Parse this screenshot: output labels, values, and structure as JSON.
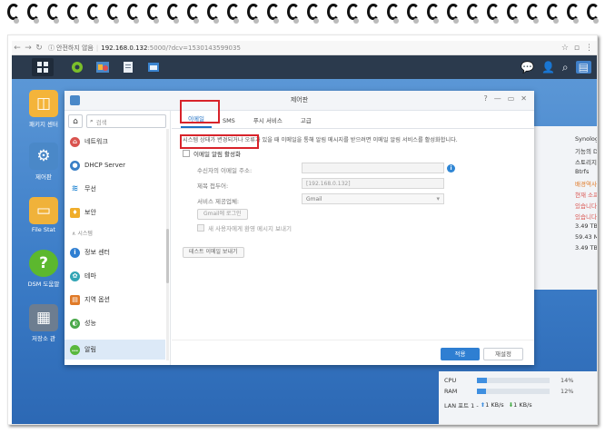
{
  "browser": {
    "security_label": "안전하지 않음",
    "host": "192.168.0.132",
    "path": ":5000/?dcv=1530143599035"
  },
  "desktop_icons": [
    {
      "label": "패키지 센터",
      "icon": "package-icon"
    },
    {
      "label": "제어판",
      "icon": "control-panel-icon"
    },
    {
      "label": "File Stat",
      "icon": "folder-icon"
    },
    {
      "label": "DSM 도움말",
      "icon": "help-icon"
    },
    {
      "label": "저장소 관",
      "icon": "storage-icon"
    }
  ],
  "widget_lines": [
    "Synolog",
    "기능의 D",
    "스토리지",
    "Btrfs",
    "배경역사",
    "현재 소프",
    "있습니다",
    "있습니다",
    "3.49 TB",
    "59.43 M",
    "3.49 TB"
  ],
  "window": {
    "title": "제어판",
    "search_placeholder": "검색",
    "sidebar_items": [
      {
        "label": "네트워크",
        "icon": "network-icon",
        "color": "#d9534f"
      },
      {
        "label": "DHCP Server",
        "icon": "dhcp-icon",
        "color": "#3a7fc6"
      },
      {
        "label": "무선",
        "icon": "wifi-icon",
        "color": "#2a8ad4"
      },
      {
        "label": "보안",
        "icon": "shield-icon",
        "color": "#f0ad2a"
      }
    ],
    "sidebar_group": "시스템",
    "sidebar_items2": [
      {
        "label": "정보 센터",
        "icon": "info-icon",
        "color": "#2f7fd2"
      },
      {
        "label": "테마",
        "icon": "theme-icon",
        "color": "#33a5b5"
      },
      {
        "label": "지역 옵션",
        "icon": "region-icon",
        "color": "#e07a28"
      },
      {
        "label": "성능",
        "icon": "performance-icon",
        "color": "#4aa84a"
      },
      {
        "label": "알림",
        "icon": "notification-icon",
        "color": "#59b83d"
      }
    ],
    "tabs": [
      "이메일",
      "SMS",
      "푸시 서비스",
      "고급"
    ],
    "description": "시스템 상태가 변경되거나 오류가 있을 때 이메일을 통해 알림 메시지를 받으려면 이메일 알림 서비스를 활성화합니다.",
    "enable_email_label": "이메일 알림 활성화",
    "fields": {
      "recipient_label": "수신자의 이메일 주소:",
      "recipient_value": "",
      "subject_prefix_label": "제목 접두어:",
      "subject_prefix_value": "[192.168.0.132]",
      "provider_label": "서비스 제공업체:",
      "provider_value": "Gmail"
    },
    "gmail_login_label": "Gmail에 로그인",
    "welcome_msg_label": "새 사용자에게 환영 메시지 보내기",
    "test_email_label": "테스트 이메일 보내기",
    "apply_label": "적용",
    "reset_label": "재설정"
  },
  "resource_monitor": {
    "cpu_label": "CPU",
    "cpu_pct": "14%",
    "cpu_value": 14,
    "ram_label": "RAM",
    "ram_pct": "12%",
    "ram_value": 12,
    "lan_label": "LAN 포트 1 -",
    "lan_up": "1 KB/s",
    "lan_down": "1 KB/s"
  },
  "colors": {
    "accent": "#2f7fd2",
    "highlight": "#d8232a",
    "taskbar": "#2b3a4d"
  }
}
